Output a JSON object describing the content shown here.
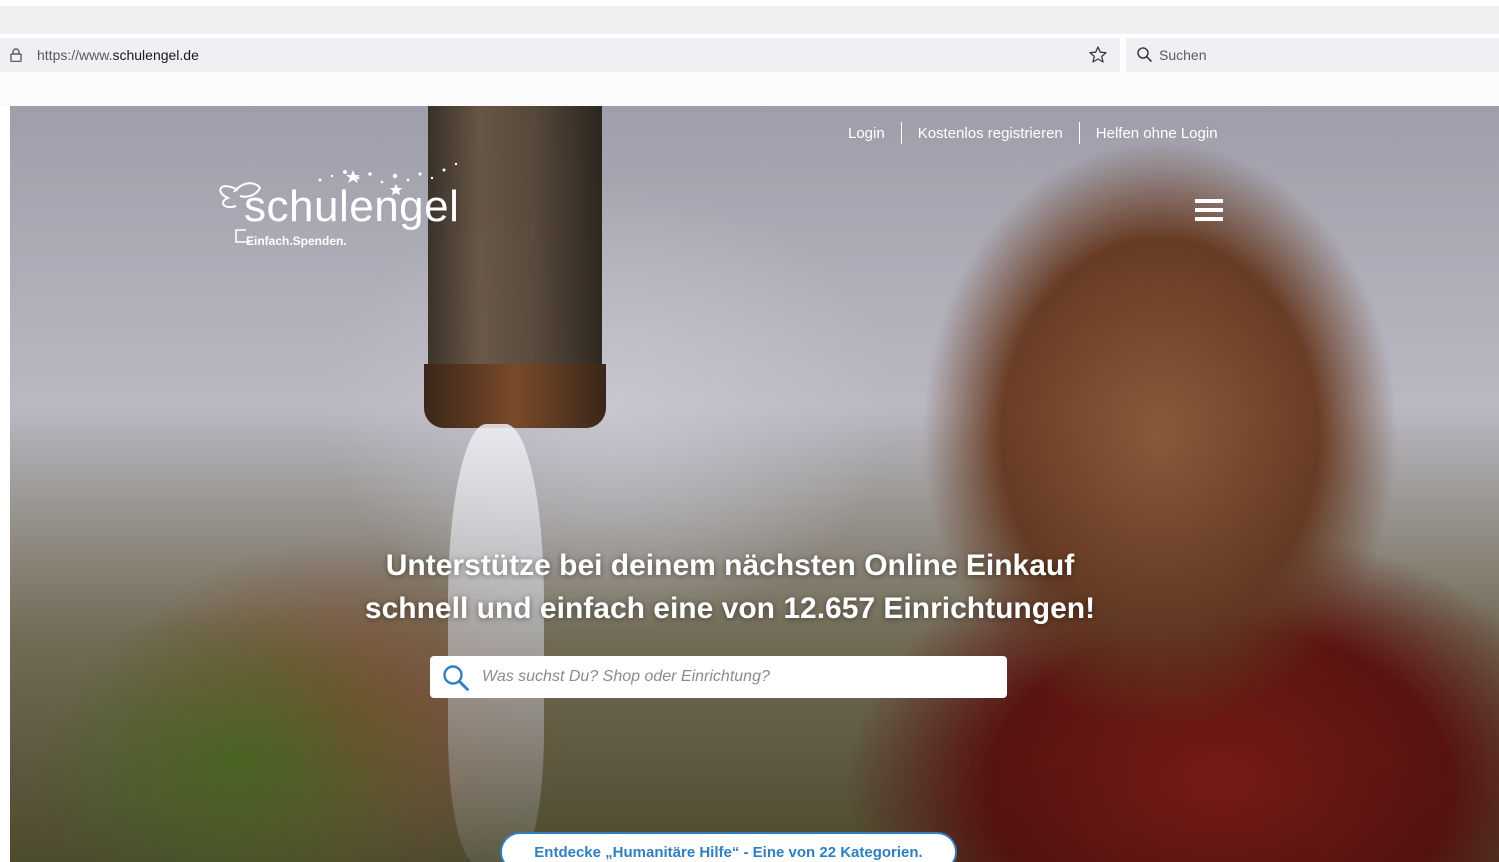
{
  "browser": {
    "url_prefix": "https://www.",
    "url_domain": "schulengel.de",
    "search_placeholder": "Suchen",
    "icons": {
      "lock": "lock-icon",
      "bookmark": "star-icon",
      "search": "search-icon"
    }
  },
  "site": {
    "nav": {
      "login": "Login",
      "register": "Kostenlos registrieren",
      "help_without_login": "Helfen ohne Login"
    },
    "logo": {
      "word": "schulengel",
      "tagline": "Einfach.Spenden."
    },
    "menu_icon": "hamburger-menu-icon",
    "headline_line1": "Unterstütze bei deinem nächsten Online Einkauf",
    "headline_line2": "schnell und einfach eine von 12.657 Einrichtungen!",
    "search": {
      "placeholder": "Was suchst Du? Shop oder Einrichtung?",
      "value": ""
    },
    "category_pill": "Entdecke „Humanitäre Hilfe“ - Eine von 22 Kategorien.",
    "colors": {
      "accent": "#2f7fc1",
      "text_on_hero": "#ffffff"
    }
  }
}
